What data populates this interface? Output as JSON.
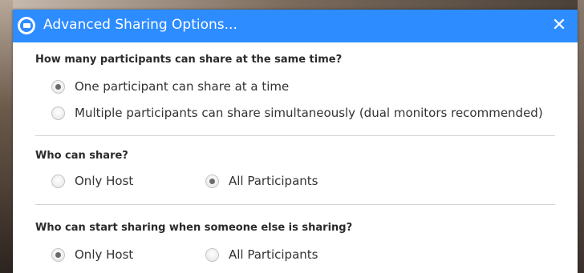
{
  "window": {
    "title": "Advanced Sharing Options...",
    "close_label": "✕",
    "accent_color": "#2d8cff"
  },
  "sections": [
    {
      "question": "How many participants can share at the same time?",
      "options": [
        {
          "label": "One participant can share at a time",
          "selected": true
        },
        {
          "label": "Multiple participants can share simultaneously (dual monitors recommended)",
          "selected": false
        }
      ]
    },
    {
      "question": "Who can share?",
      "options": [
        {
          "label": "Only Host",
          "selected": false
        },
        {
          "label": "All Participants",
          "selected": true
        }
      ]
    },
    {
      "question": "Who can start sharing when someone else is sharing?",
      "options": [
        {
          "label": "Only Host",
          "selected": true
        },
        {
          "label": "All Participants",
          "selected": false
        }
      ]
    }
  ]
}
